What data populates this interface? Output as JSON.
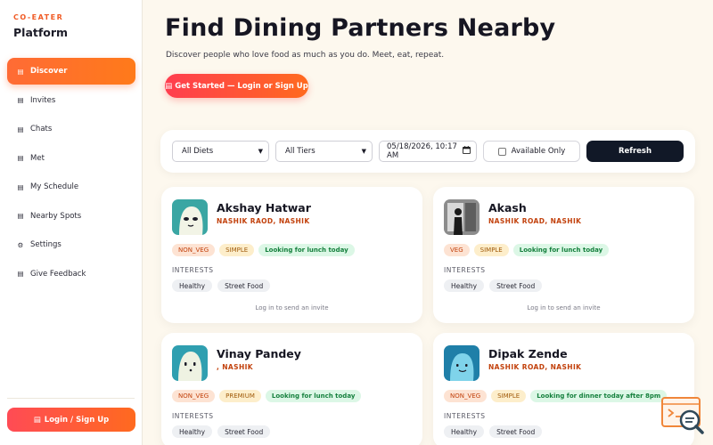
{
  "brand": {
    "kicker": "CO-EATER",
    "title": "Platform"
  },
  "nav": [
    {
      "label": "Discover",
      "icon": "page-icon",
      "glyph": "▤",
      "active": true
    },
    {
      "label": "Invites",
      "icon": "page-icon",
      "glyph": "▤"
    },
    {
      "label": "Chats",
      "icon": "page-icon",
      "glyph": "▤"
    },
    {
      "label": "Met",
      "icon": "page-icon",
      "glyph": "▤"
    },
    {
      "label": "My Schedule",
      "icon": "page-icon",
      "glyph": "▤"
    },
    {
      "label": "Nearby Spots",
      "icon": "page-icon",
      "glyph": "▤"
    },
    {
      "label": "Settings",
      "icon": "gear-icon",
      "glyph": "⚙"
    },
    {
      "label": "Give Feedback",
      "icon": "page-icon",
      "glyph": "▤"
    }
  ],
  "login": {
    "icon_glyph": "▤",
    "label": "Login / Sign Up"
  },
  "hero": {
    "title": "Find Dining Partners Nearby",
    "subtitle": "Discover people who love food as much as you do. Meet, eat, repeat.",
    "cta_icon": "▤",
    "cta_label": "Get Started — Login or Sign Up"
  },
  "filters": {
    "diet": "All Diets",
    "tier": "All Tiers",
    "datetime": "05/18/2026, 10:17 AM",
    "available_only": "Available Only",
    "refresh": "Refresh"
  },
  "cards": [
    {
      "name": "Akshay Hatwar",
      "location": "NASHIK RAOD, NASHIK",
      "diet": "NON_VEG",
      "tier": "SIMPLE",
      "status": "Looking for lunch today",
      "interests_label": "INTERESTS",
      "interests": [
        "Healthy",
        "Street Food"
      ],
      "hint": "Log in to send an invite"
    },
    {
      "name": "Akash",
      "location": "NASHIK ROAD, NASHIK",
      "diet": "VEG",
      "tier": "SIMPLE",
      "status": "Looking for lunch today",
      "interests_label": "INTERESTS",
      "interests": [
        "Healthy",
        "Street Food"
      ],
      "hint": "Log in to send an invite"
    },
    {
      "name": "Vinay Pandey",
      "location": ", NASHIK",
      "diet": "NON_VEG",
      "tier": "PREMIUM",
      "status": "Looking for lunch today",
      "interests_label": "INTERESTS",
      "interests": [
        "Healthy",
        "Street Food"
      ]
    },
    {
      "name": "Dipak Zende",
      "location": "NASHIK ROAD, NASHIK",
      "diet": "NON_VEG",
      "tier": "SIMPLE",
      "status": "Looking for dinner today after 8pm",
      "interests_label": "INTERESTS",
      "interests": [
        "Healthy",
        "Street Food"
      ]
    }
  ],
  "colors": {
    "accent": "#ff6b35",
    "background": "#fdf8ee",
    "dark_button": "#111827",
    "location": "#c2410c",
    "status_green": "#15803d"
  }
}
